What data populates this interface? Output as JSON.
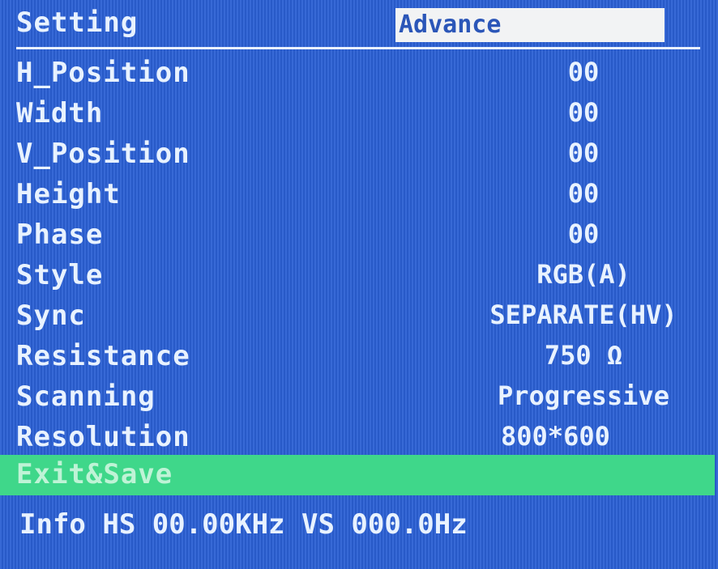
{
  "header": {
    "title": "Setting",
    "tab": "Advance"
  },
  "menu": {
    "items": [
      {
        "label": "H_Position",
        "value": "00"
      },
      {
        "label": "Width",
        "value": "00"
      },
      {
        "label": "V_Position",
        "value": "00"
      },
      {
        "label": "Height",
        "value": "00"
      },
      {
        "label": "Phase",
        "value": "00"
      },
      {
        "label": "Style",
        "value": "RGB(A)"
      },
      {
        "label": "Sync",
        "value": "SEPARATE(HV)"
      },
      {
        "label": "Resistance",
        "value": "750 Ω"
      },
      {
        "label": "Scanning",
        "value": "Progressive"
      },
      {
        "label": "Resolution",
        "value": "800*600"
      }
    ],
    "exit_label": "Exit&Save"
  },
  "info": {
    "text": "Info HS 00.00KHz VS 000.0Hz"
  },
  "colors": {
    "background": "#2b60d4",
    "highlight": "#3fd78a",
    "text": "#e8f2ff"
  }
}
